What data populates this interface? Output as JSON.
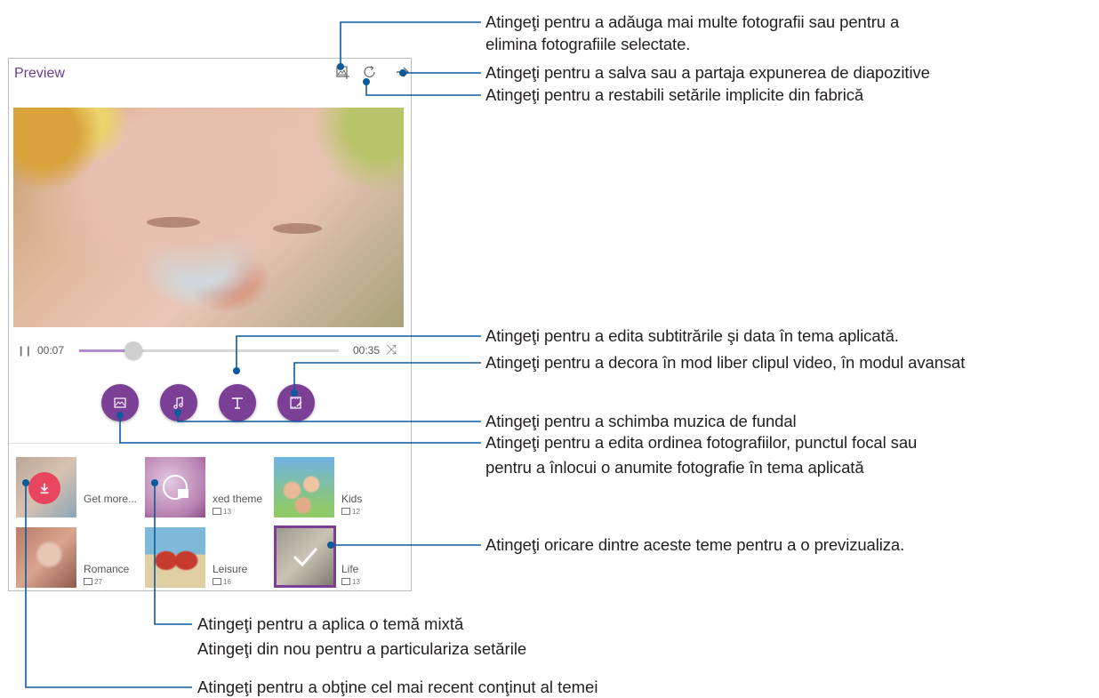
{
  "app": {
    "title": "Preview"
  },
  "player": {
    "elapsed": "00:07",
    "total": "00:35",
    "progress_fraction": 0.21
  },
  "themes": [
    {
      "name": "Get more...",
      "count": ""
    },
    {
      "name": "xed theme",
      "count": "13"
    },
    {
      "name": "Kids",
      "count": "12"
    },
    {
      "name": "Romance",
      "count": "27"
    },
    {
      "name": "Leisure",
      "count": "16"
    },
    {
      "name": "Life",
      "count": "13"
    }
  ],
  "callouts": {
    "add_photos_line1": "Atingeţi pentru a adăuga mai multe fotografii sau pentru a",
    "add_photos_line2": "elimina fotografiile selectate.",
    "save_share": "Atingeţi pentru a salva sau a partaja expunerea de diapozitive",
    "reset": "Atingeţi pentru a restabili setările implicite din fabrică",
    "subtitles": "Atingeţi pentru a edita subtitrările şi data în tema aplicată.",
    "decorate": "Atingeţi pentru a decora în mod liber clipul video, în modul avansat",
    "music": "Atingeţi pentru a schimba muzica de fundal",
    "order_line1": "Atingeţi pentru a edita ordinea fotografiilor, punctul focal sau",
    "order_line2": "pentru a înlocui o anumite fotografie în tema aplicată",
    "preview_theme": "Atingeţi oricare dintre aceste teme pentru a o previzualiza.",
    "mixed_line1": "Atingeţi pentru a aplica o temă mixtă",
    "mixed_line2": "Atingeţi din nou pentru a particulariza setările",
    "latest": "Atingeţi pentru a obţine cel mai recent conţinut al temei"
  },
  "colors": {
    "accent": "#7b3f95",
    "callout_line": "#0b5a9e",
    "download_badge": "#e8455e"
  },
  "icons": {
    "add_photo": "photo-plus-icon",
    "reset": "refresh-icon",
    "share": "arrow-right-icon",
    "photos": "image-icon",
    "music": "music-note-icon",
    "text": "text-T-icon",
    "decorate": "edit-film-icon"
  }
}
